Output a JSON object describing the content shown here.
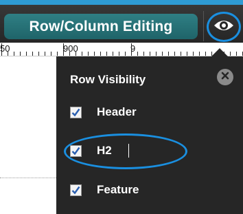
{
  "toolbar": {
    "row_column_label": "Row/Column Editing",
    "accent_color": "#2e9bd4",
    "button_color": "#2a777c",
    "visibility_icon": "eye-icon",
    "highlight_color": "#1a8fe0"
  },
  "ruler": {
    "labels": [
      "50",
      "900",
      "9"
    ]
  },
  "panel": {
    "title": "Row Visibility",
    "close_icon": "close-icon",
    "rows": [
      {
        "label": "Header",
        "checked": true
      },
      {
        "label": "H2",
        "checked": true
      },
      {
        "label": "Feature",
        "checked": true
      }
    ]
  }
}
